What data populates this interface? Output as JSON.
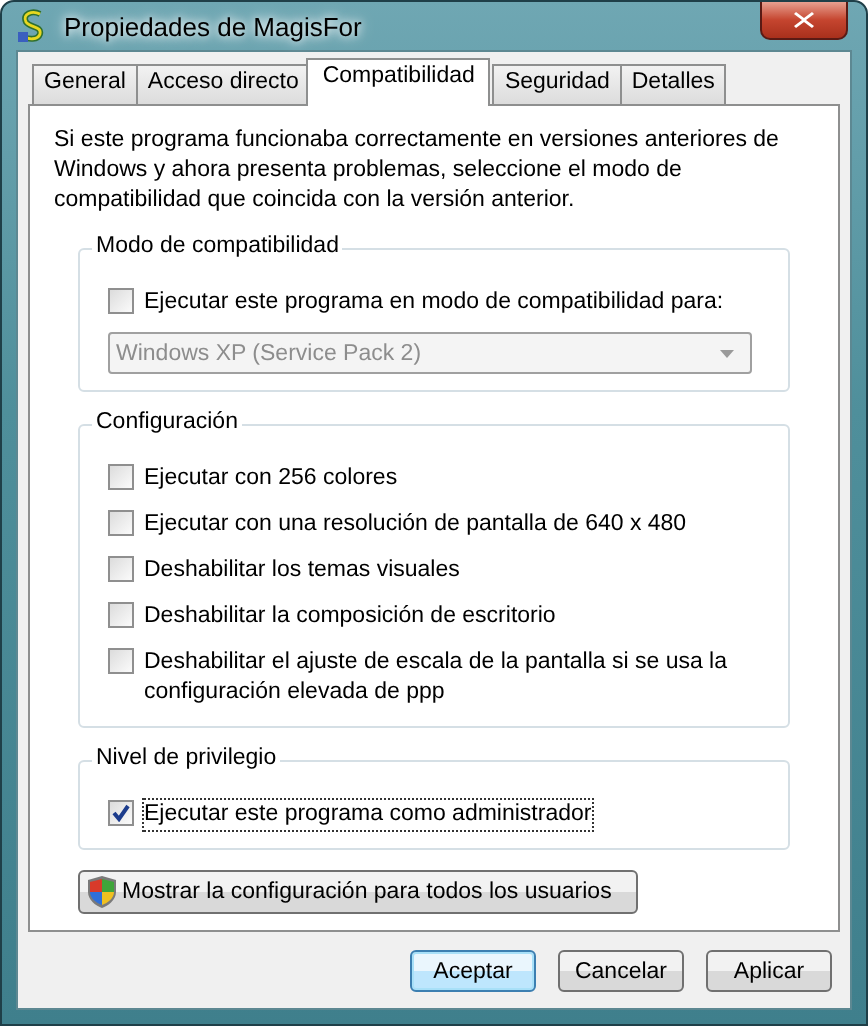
{
  "window": {
    "title": "Propiedades de MagisFor"
  },
  "tabs": [
    {
      "label": "General",
      "selected": false
    },
    {
      "label": "Acceso directo",
      "selected": false
    },
    {
      "label": "Compatibilidad",
      "selected": true
    },
    {
      "label": "Seguridad",
      "selected": false
    },
    {
      "label": "Detalles",
      "selected": false
    }
  ],
  "intro": "Si este programa funcionaba correctamente en versiones anteriores de Windows y ahora presenta problemas, seleccione el modo de compatibilidad que coincida con la versión anterior.",
  "groups": [
    {
      "title": "Modo de compatibilidad",
      "items": [
        {
          "kind": "checkbox",
          "label": "Ejecutar este programa en modo de compatibilidad para:",
          "checked": false
        },
        {
          "kind": "dropdown",
          "value": "Windows XP (Service Pack 2)",
          "disabled": true
        }
      ]
    },
    {
      "title": "Configuración",
      "items": [
        {
          "kind": "checkbox",
          "label": "Ejecutar con 256 colores",
          "checked": false
        },
        {
          "kind": "checkbox",
          "label": "Ejecutar con una resolución de pantalla de 640 x 480",
          "checked": false
        },
        {
          "kind": "checkbox",
          "label": "Deshabilitar los temas visuales",
          "checked": false
        },
        {
          "kind": "checkbox",
          "label": "Deshabilitar la composición de escritorio",
          "checked": false
        },
        {
          "kind": "checkbox",
          "label": "Deshabilitar el ajuste de escala de la pantalla si se usa la configuración elevada de ppp",
          "checked": false
        }
      ]
    },
    {
      "title": "Nivel de privilegio",
      "items": [
        {
          "kind": "checkbox",
          "label": "Ejecutar este programa como administrador",
          "checked": true,
          "focused": true
        }
      ]
    }
  ],
  "shield_button": {
    "label": "Mostrar la configuración para todos los usuarios"
  },
  "buttons": [
    {
      "label": "Aceptar",
      "default": true
    },
    {
      "label": "Cancelar",
      "default": false
    },
    {
      "label": "Aplicar",
      "default": false
    }
  ]
}
